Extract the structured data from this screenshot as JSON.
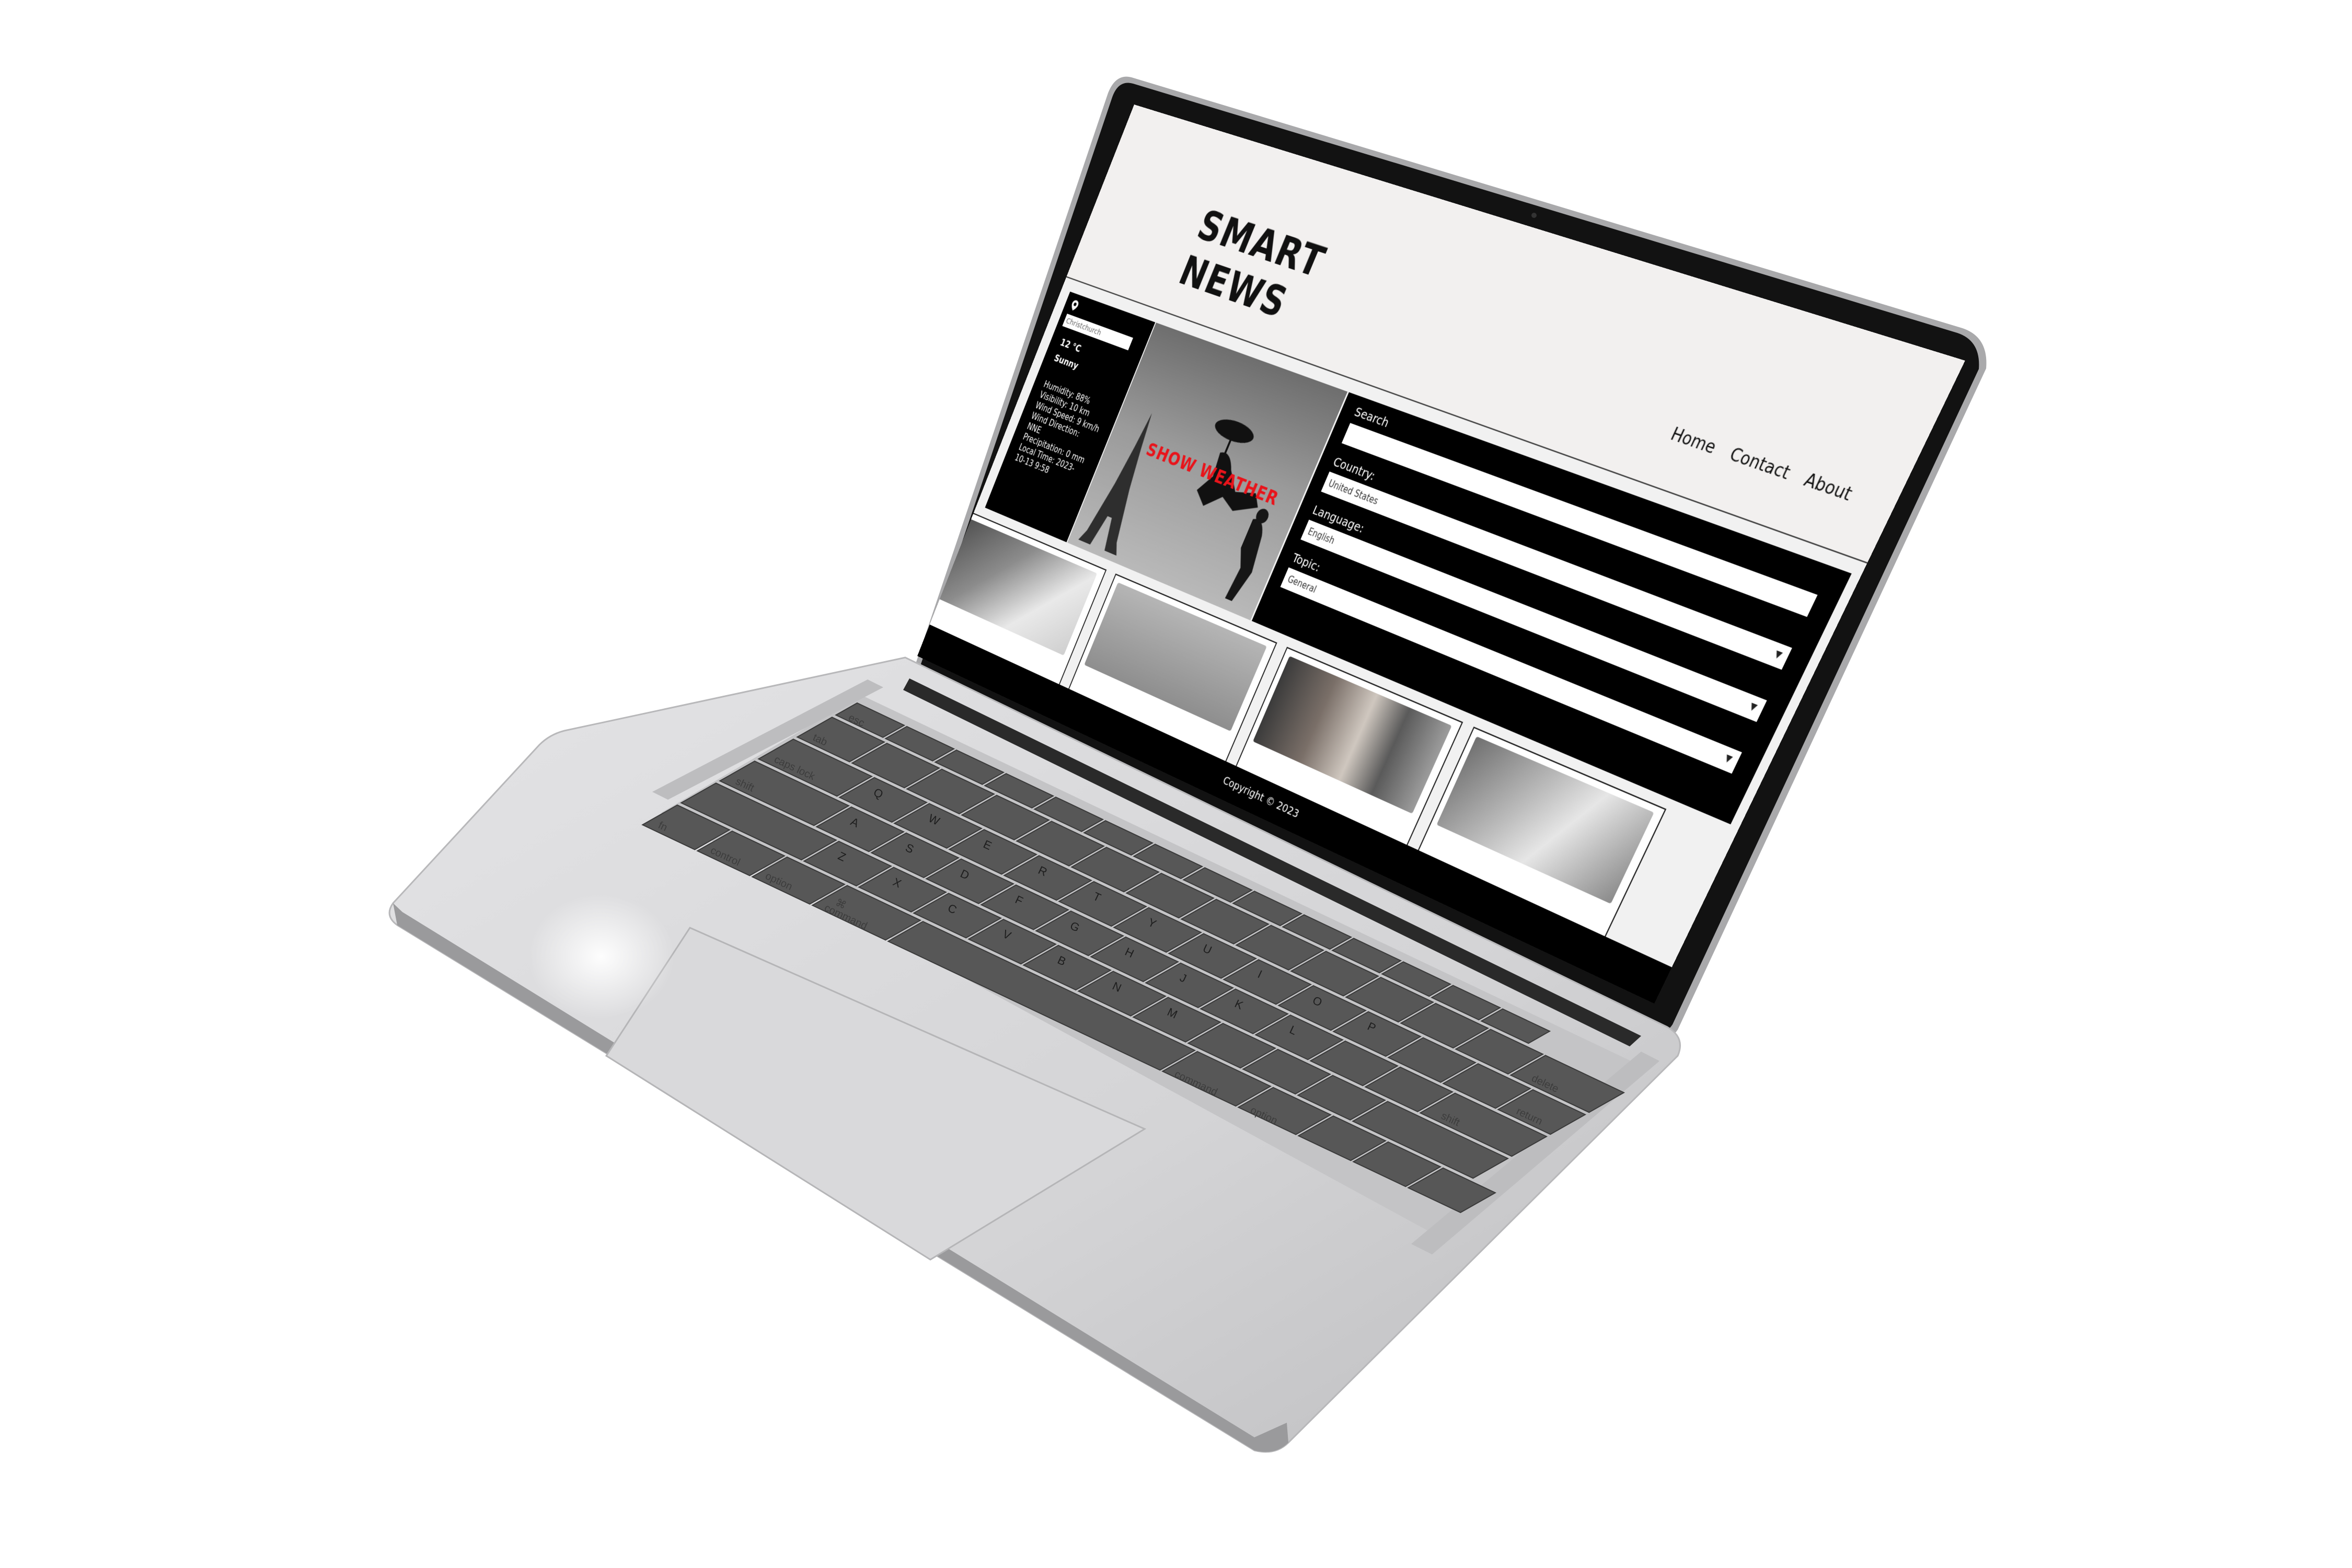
{
  "site": {
    "logo_line1": "SMART",
    "logo_line2": "NEWS",
    "nav": {
      "home": "Home",
      "contact": "Contact",
      "about": "About"
    }
  },
  "weather": {
    "city_value": "Christchurch",
    "temperature": "12 °C",
    "condition": "Sunny",
    "humidity": "Humidity: 88%",
    "visibility": "Visibility: 10 km",
    "wind_speed": "Wind Speed: 9 km/h",
    "wind_direction": "Wind Direction:",
    "wind_direction_value": "NNE",
    "precipitation": "Precipitation: 0 mm",
    "local_time": "Local Time: 2023-",
    "local_time_cont": "10-13 9:58"
  },
  "hero": {
    "overlay_text": "SHOW WEATHER"
  },
  "search_panel": {
    "search_label": "Search",
    "search_value": "",
    "country_label": "Country:",
    "country_value": "United States",
    "language_label": "Language:",
    "language_value": "English",
    "topic_label": "Topic:",
    "topic_value": "General"
  },
  "footer": {
    "copyright": "Copyright © 2023"
  },
  "keyboard": {
    "esc": "esc",
    "tab": "tab",
    "caps_lock": "caps lock",
    "shift_left": "shift",
    "fn": "fn",
    "control": "control",
    "option_left": "option",
    "command_left": "command",
    "command_symbol": "⌘",
    "command_right": "command",
    "option_right": "option",
    "delete": "delete",
    "return": "return",
    "shift_right": "shift",
    "letters": [
      "Q",
      "W",
      "E",
      "R",
      "T",
      "Y",
      "U",
      "I",
      "O",
      "P",
      "A",
      "S",
      "D",
      "F",
      "G",
      "H",
      "J",
      "K",
      "L",
      "Z",
      "X",
      "C",
      "V",
      "B",
      "N",
      "M"
    ]
  },
  "colors": {
    "accent_red": "#e8141b",
    "panel_black": "#000000",
    "laptop_silver": "#d6d6d8",
    "bezel": "#121212",
    "keycap": "#575757"
  },
  "icons": [
    "location-pin-icon",
    "chevron-down-icon"
  ]
}
